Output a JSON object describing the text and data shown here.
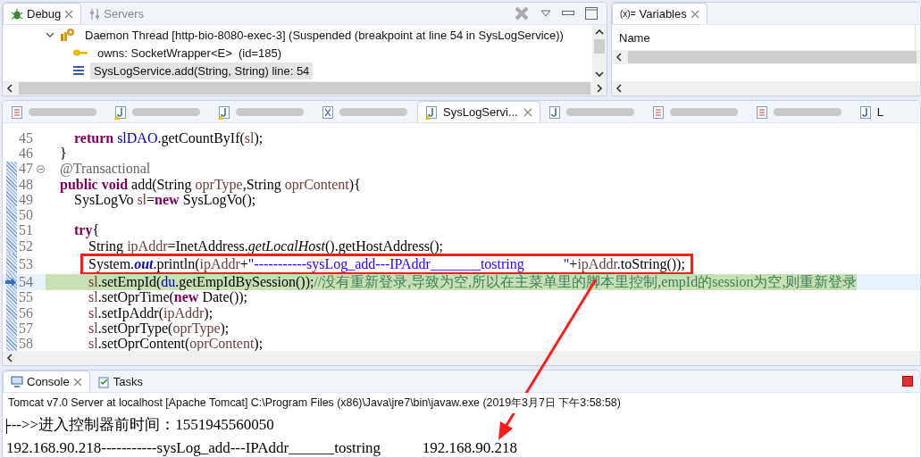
{
  "debug_view": {
    "tabs": [
      {
        "label": "Debug",
        "selected": true
      },
      {
        "label": "Servers",
        "selected": false
      }
    ],
    "tree": [
      {
        "kind": "thread",
        "label": "Daemon Thread [http-bio-8080-exec-3] (Suspended (breakpoint at line 54 in SysLogService))",
        "expanded": true,
        "selected": false,
        "children": [
          {
            "kind": "monitor",
            "label": "owns: SocketWrapper<E>  (id=185)",
            "selected": false
          },
          {
            "kind": "frame",
            "label": "SysLogService.add(String, String) line: 54",
            "selected": true
          }
        ]
      }
    ]
  },
  "variables_view": {
    "tabs": [
      {
        "glyph": "(x)=",
        "label": "Variables",
        "selected": true
      }
    ],
    "columns": [
      "Name"
    ]
  },
  "editor": {
    "tabs": [
      {
        "kind": "jsp",
        "warning": false,
        "selected": false
      },
      {
        "kind": "java",
        "warning": true,
        "selected": false
      },
      {
        "kind": "java",
        "warning": true,
        "selected": false
      },
      {
        "kind": "xml",
        "warning": false,
        "selected": false
      },
      {
        "kind": "java",
        "warning": true,
        "selected": true,
        "label": "SysLogServi..."
      },
      {
        "kind": "java",
        "warning": false,
        "selected": false
      },
      {
        "kind": "jsp",
        "warning": false,
        "selected": false
      },
      {
        "kind": "jsp",
        "warning": false,
        "selected": false
      },
      {
        "kind": "java",
        "warning": false,
        "selected": false,
        "label": "L"
      }
    ],
    "lines": [
      {
        "children": [
          {
            "number": "45",
            "changed": false,
            "tokens": [
              {
                "text": "return",
                "kind": "keyword"
              },
              {
                "text": " slDAO",
                "kind": "field"
              },
              {
                "text": ".getCountByIf(",
                "kind": "plain"
              },
              {
                "text": "sl",
                "kind": "local"
              },
              {
                "text": ");",
                "kind": "plain"
              }
            ]
          }
        ]
      },
      {
        "number": "46",
        "changed": false,
        "tokens": [
          {
            "text": "}",
            "kind": "plain"
          }
        ]
      },
      {
        "number": "47",
        "changed": true,
        "foldable": true,
        "tokens": [
          {
            "text": "@Transactional",
            "kind": "annotation"
          }
        ]
      },
      {
        "number": "48",
        "changed": true,
        "tokens": [
          {
            "text": "public void",
            "kind": "keyword"
          },
          {
            "text": " add(String ",
            "kind": "plain"
          },
          {
            "text": "oprType",
            "kind": "local"
          },
          {
            "text": ",String ",
            "kind": "plain"
          },
          {
            "text": "oprContent",
            "kind": "local"
          },
          {
            "text": "){",
            "kind": "plain"
          }
        ],
        "children": [
          {
            "number": "49",
            "changed": true,
            "tokens": [
              {
                "text": "SysLogVo ",
                "kind": "plain"
              },
              {
                "text": "sl",
                "kind": "local"
              },
              {
                "text": "=",
                "kind": "plain"
              },
              {
                "text": "new",
                "kind": "keyword"
              },
              {
                "text": " SysLogVo();",
                "kind": "plain"
              }
            ]
          },
          {
            "number": "50",
            "changed": true
          },
          {
            "number": "51",
            "changed": true,
            "tokens": [
              {
                "text": "try",
                "kind": "keyword"
              },
              {
                "text": "{",
                "kind": "plain"
              }
            ],
            "children": [
              {
                "number": "52",
                "changed": true,
                "tokens": [
                  {
                    "text": "String ",
                    "kind": "plain"
                  },
                  {
                    "text": "ipAddr",
                    "kind": "local"
                  },
                  {
                    "text": "=InetAddress.",
                    "kind": "plain"
                  },
                  {
                    "text": "getLocalHost",
                    "kind": "static-method"
                  },
                  {
                    "text": "().getHostAddress();",
                    "kind": "plain"
                  }
                ]
              },
              {
                "number": "53",
                "changed": true,
                "boxed": true,
                "tokens": [
                  {
                    "text": "System.",
                    "kind": "plain"
                  },
                  {
                    "text": "out",
                    "kind": "static-field"
                  },
                  {
                    "text": ".println(",
                    "kind": "plain"
                  },
                  {
                    "text": "ipAddr",
                    "kind": "local"
                  },
                  {
                    "text": "+",
                    "kind": "plain"
                  },
                  {
                    "text": "\"-----------sysLog_add---IPAddr_______tostring           \"",
                    "kind": "string"
                  },
                  {
                    "text": "+",
                    "kind": "plain"
                  },
                  {
                    "text": "ipAddr",
                    "kind": "local"
                  },
                  {
                    "text": ".toString());",
                    "kind": "plain"
                  }
                ]
              },
              {
                "number": "54",
                "changed": true,
                "current": true,
                "tokens": [
                  {
                    "text": "sl",
                    "kind": "local"
                  },
                  {
                    "text": ".setEmpId(",
                    "kind": "plain"
                  },
                  {
                    "text": "du",
                    "kind": "field"
                  },
                  {
                    "text": ".getEmpIdBySession());",
                    "kind": "plain"
                  },
                  {
                    "text": "//没有重新登录,导致为空,所以在主菜单里的脚本里控制,empId的session为空,则重新登录",
                    "kind": "comment"
                  }
                ]
              },
              {
                "number": "55",
                "changed": true,
                "tokens": [
                  {
                    "text": "sl",
                    "kind": "local"
                  },
                  {
                    "text": ".setOprTime(",
                    "kind": "plain"
                  },
                  {
                    "text": "new",
                    "kind": "keyword"
                  },
                  {
                    "text": " Date());",
                    "kind": "plain"
                  }
                ]
              },
              {
                "number": "56",
                "changed": true,
                "tokens": [
                  {
                    "text": "sl",
                    "kind": "local"
                  },
                  {
                    "text": ".setIpAddr(",
                    "kind": "plain"
                  },
                  {
                    "text": "ipAddr",
                    "kind": "local"
                  },
                  {
                    "text": ");",
                    "kind": "plain"
                  }
                ]
              },
              {
                "number": "57",
                "changed": true,
                "tokens": [
                  {
                    "text": "sl",
                    "kind": "local"
                  },
                  {
                    "text": ".setOprType(",
                    "kind": "plain"
                  },
                  {
                    "text": "oprType",
                    "kind": "local"
                  },
                  {
                    "text": ");",
                    "kind": "plain"
                  }
                ]
              },
              {
                "number": "58",
                "changed": true,
                "tokens": [
                  {
                    "text": "sl",
                    "kind": "local"
                  },
                  {
                    "text": ".setOprContent(",
                    "kind": "plain"
                  },
                  {
                    "text": "oprContent",
                    "kind": "local"
                  },
                  {
                    "text": ");",
                    "kind": "plain"
                  }
                ]
              }
            ]
          }
        ]
      }
    ]
  },
  "console_view": {
    "tabs": [
      {
        "kind": "console",
        "label": "Console",
        "selected": true
      },
      {
        "kind": "tasks",
        "label": "Tasks",
        "selected": false
      }
    ],
    "description": "Tomcat v7.0 Server at localhost [Apache Tomcat] C:\\Program Files (x86)\\Java\\jre7\\bin\\javaw.exe (2019年3月7日 下午3:58:58)",
    "output": [
      "--->>进入控制器前时间：1551945560050",
      "192.168.90.218-----------sysLog_add---IPAddr______tostring           192.168.90.218"
    ]
  }
}
